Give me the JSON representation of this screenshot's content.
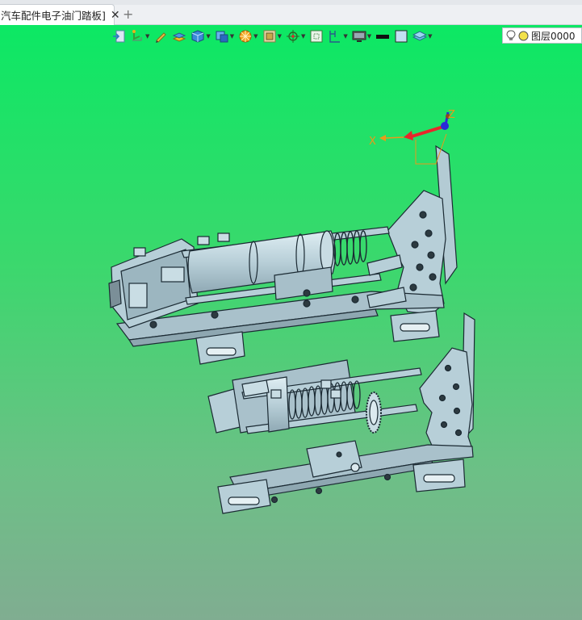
{
  "tab": {
    "title": "汽车配件电子油门踏板]",
    "close_glyph": "✕",
    "new_tab_glyph": "+"
  },
  "toolbar": {
    "buttons": [
      {
        "icon": "exit-sketch-icon",
        "dropdown": false
      },
      {
        "icon": "workplane-icon",
        "dropdown": true
      },
      {
        "icon": "pencil-icon",
        "dropdown": false
      },
      {
        "icon": "extrude-icon",
        "dropdown": false
      },
      {
        "icon": "solid-cube-icon",
        "dropdown": true
      },
      {
        "icon": "view-orientation-icon",
        "dropdown": true
      },
      {
        "icon": "render-style-icon",
        "dropdown": true
      },
      {
        "icon": "section-view-icon",
        "dropdown": true
      },
      {
        "icon": "snap-target-icon",
        "dropdown": true
      },
      {
        "icon": "grid-icon",
        "dropdown": false
      },
      {
        "icon": "dimension-icon",
        "dropdown": true
      },
      {
        "icon": "monitor-icon",
        "dropdown": true
      },
      {
        "icon": "line-color-icon",
        "dropdown": false
      },
      {
        "icon": "fill-color-icon",
        "dropdown": false
      },
      {
        "icon": "layer-stack-icon",
        "dropdown": true
      }
    ]
  },
  "layer": {
    "label": "图层0000",
    "bulb_icon": "lightbulb-icon",
    "color_icon": "layer-color-icon"
  },
  "triad": {
    "x_label": "X",
    "z_label": "Z",
    "y_label": "Y"
  },
  "colors": {
    "viewport_top": "#0ce864",
    "viewport_bottom": "#80ad91",
    "part_fill": "#b7cfd8",
    "part_edge": "#1b2a33",
    "axis_x": "#e8262b",
    "axis_y": "#e89a1a",
    "axis_z": "#2a2ad8"
  }
}
